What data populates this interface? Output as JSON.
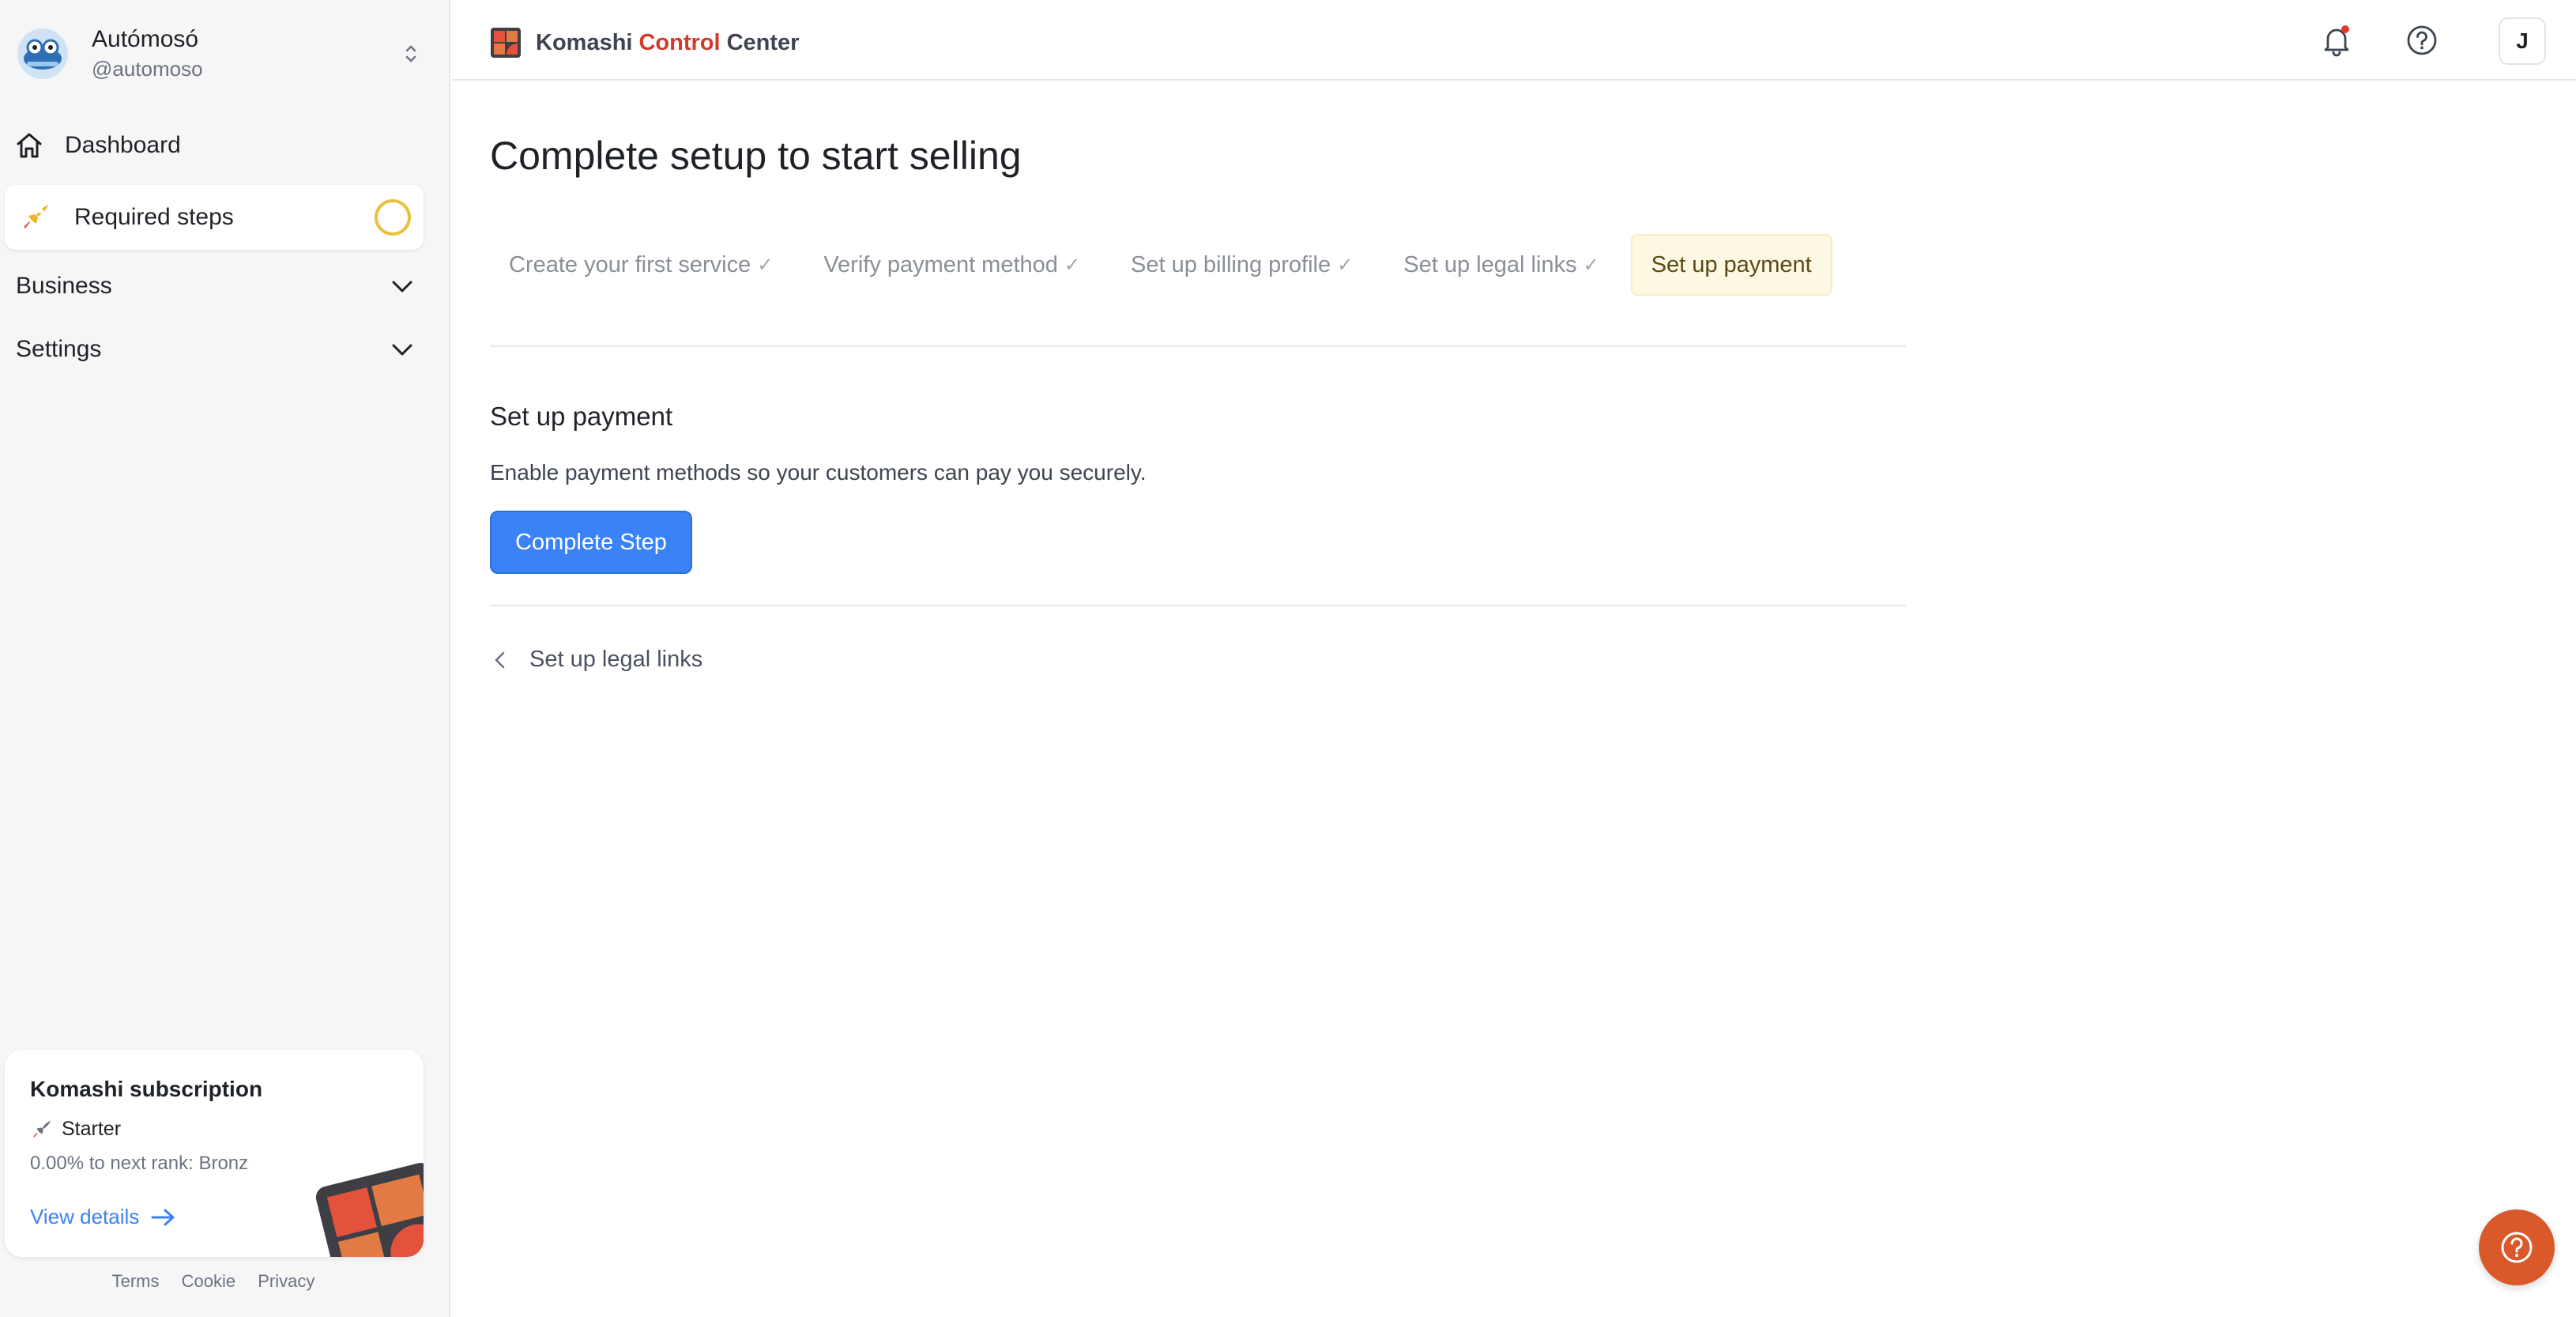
{
  "sidebar": {
    "account": {
      "name": "Autómosó",
      "handle": "@automoso"
    },
    "nav": {
      "dashboard": "Dashboard",
      "required_steps": "Required steps",
      "business": "Business",
      "settings": "Settings"
    },
    "subscription": {
      "title": "Komashi subscription",
      "plan": "Starter",
      "rank_text": "0.00% to next rank: Bronz",
      "link": "View details"
    },
    "footer": {
      "terms": "Terms",
      "cookie": "Cookie",
      "privacy": "Privacy"
    }
  },
  "topbar": {
    "brand_part1": "Komashi",
    "brand_part2": "Control",
    "brand_part3": "Center",
    "user_initial": "J",
    "notification_dot": true
  },
  "main": {
    "title": "Complete setup to start selling",
    "steps": [
      {
        "label": "Create your first service",
        "done": true
      },
      {
        "label": "Verify payment method",
        "done": true
      },
      {
        "label": "Set up billing profile",
        "done": true
      },
      {
        "label": "Set up legal links",
        "done": true
      },
      {
        "label": "Set up payment",
        "done": false
      }
    ],
    "check_mark": "✓",
    "section_title": "Set up payment",
    "section_desc": "Enable payment methods so your customers can pay you securely.",
    "button": "Complete Step",
    "back": "Set up legal links"
  },
  "colors": {
    "accent_blue": "#3b82f6",
    "brand_red": "#d23a2c",
    "active_step_bg": "#fdf8e1",
    "fab_orange": "#d9592b"
  },
  "icons": [
    "home-icon",
    "rocket-icon",
    "chevron-down-icon",
    "chevron-updown-icon",
    "bell-icon",
    "help-icon",
    "arrow-right-icon",
    "chevron-left-icon",
    "question-icon"
  ]
}
